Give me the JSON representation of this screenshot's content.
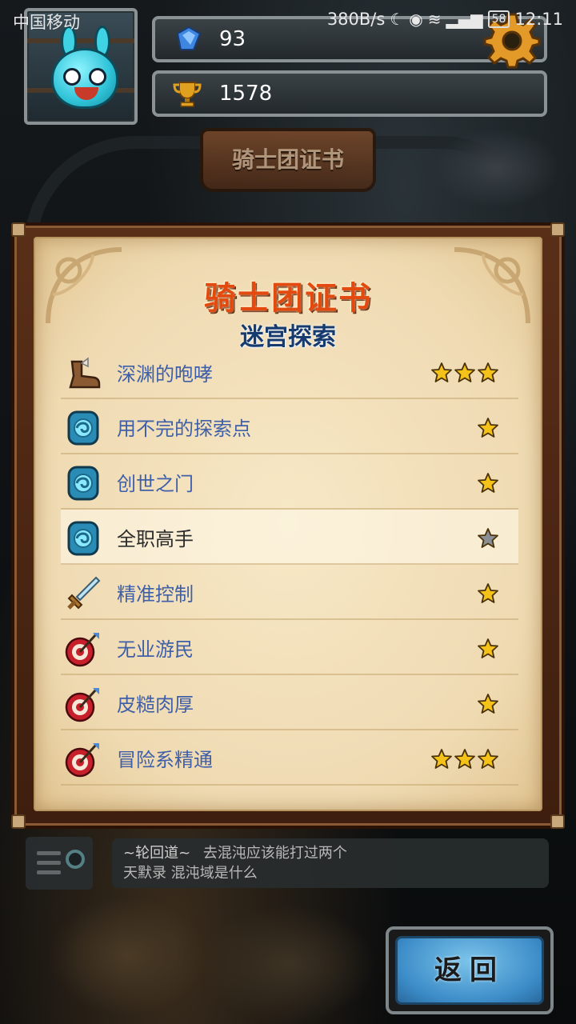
{
  "status_bar": {
    "carrier": "中国移动",
    "net_speed": "380B/s",
    "battery": "58",
    "time": "12:11"
  },
  "resources": {
    "gems": "93",
    "trophies": "1578"
  },
  "header_sign": "骑士团证书",
  "panel": {
    "title": "骑士团证书",
    "subtitle": "迷宫探索",
    "items": [
      {
        "label": "深渊的咆哮",
        "icon": "boot-icon",
        "stars": 3,
        "state": "done"
      },
      {
        "label": "用不完的探索点",
        "icon": "portal-icon",
        "stars": 1,
        "state": "done"
      },
      {
        "label": "创世之门",
        "icon": "portal-icon",
        "stars": 1,
        "state": "done"
      },
      {
        "label": "全职高手",
        "icon": "portal-icon",
        "stars": 1,
        "state": "locked"
      },
      {
        "label": "精准控制",
        "icon": "sword-icon",
        "stars": 1,
        "state": "done"
      },
      {
        "label": "无业游民",
        "icon": "target-icon",
        "stars": 1,
        "state": "done"
      },
      {
        "label": "皮糙肉厚",
        "icon": "target-icon",
        "stars": 1,
        "state": "done"
      },
      {
        "label": "冒险系精通",
        "icon": "target-icon",
        "stars": 3,
        "state": "done"
      }
    ]
  },
  "chat": {
    "channel": "~轮回道~",
    "line1": "去混沌应该能打过两个",
    "line2": "天默录 混沌域是什么"
  },
  "back_button": "返回",
  "colors": {
    "star_gold": "#f5c21a",
    "star_gray": "#8a8f96",
    "title_orange": "#e34a10",
    "subtitle_blue": "#173b6e",
    "label_blue": "#3f5fa8"
  }
}
